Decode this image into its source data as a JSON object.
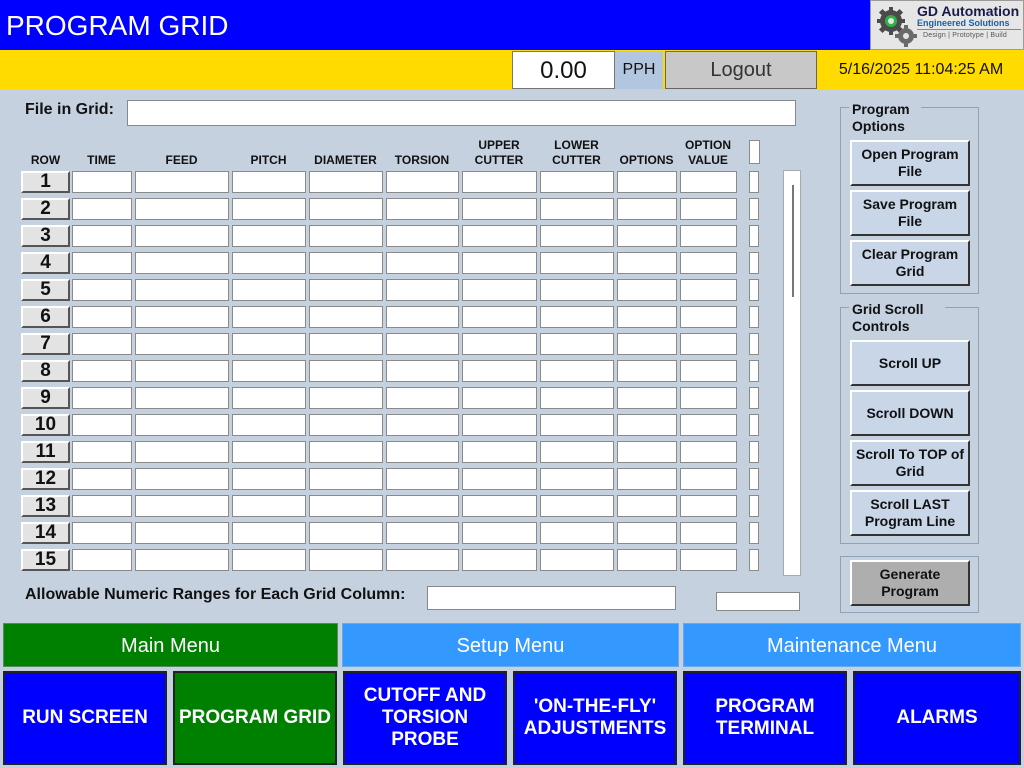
{
  "header": {
    "title": "PROGRAM GRID",
    "logo": {
      "name": "GD Automation",
      "tagline": "Engineered Solutions",
      "subline": "Design | Prototype | Build",
      "icon": "gear-logo-icon"
    }
  },
  "statusbar": {
    "pph_value": "0.00",
    "pph_label": "PPH",
    "logout_label": "Logout",
    "datetime": "5/16/2025 11:04:25 AM"
  },
  "file": {
    "label": "File in Grid:",
    "value": ""
  },
  "grid": {
    "columns": [
      "ROW",
      "TIME",
      "FEED",
      "PITCH",
      "DIAMETER",
      "TORSION",
      "UPPER CUTTER",
      "LOWER CUTTER",
      "OPTIONS",
      "OPTION VALUE"
    ],
    "rows": [
      "1",
      "2",
      "3",
      "4",
      "5",
      "6",
      "7",
      "8",
      "9",
      "10",
      "11",
      "12",
      "13",
      "14",
      "15"
    ],
    "cells": [
      [
        "",
        "",
        "",
        "",
        "",
        "",
        "",
        "",
        ""
      ],
      [
        "",
        "",
        "",
        "",
        "",
        "",
        "",
        "",
        ""
      ],
      [
        "",
        "",
        "",
        "",
        "",
        "",
        "",
        "",
        ""
      ],
      [
        "",
        "",
        "",
        "",
        "",
        "",
        "",
        "",
        ""
      ],
      [
        "",
        "",
        "",
        "",
        "",
        "",
        "",
        "",
        ""
      ],
      [
        "",
        "",
        "",
        "",
        "",
        "",
        "",
        "",
        ""
      ],
      [
        "",
        "",
        "",
        "",
        "",
        "",
        "",
        "",
        ""
      ],
      [
        "",
        "",
        "",
        "",
        "",
        "",
        "",
        "",
        ""
      ],
      [
        "",
        "",
        "",
        "",
        "",
        "",
        "",
        "",
        ""
      ],
      [
        "",
        "",
        "",
        "",
        "",
        "",
        "",
        "",
        ""
      ],
      [
        "",
        "",
        "",
        "",
        "",
        "",
        "",
        "",
        ""
      ],
      [
        "",
        "",
        "",
        "",
        "",
        "",
        "",
        "",
        ""
      ],
      [
        "",
        "",
        "",
        "",
        "",
        "",
        "",
        "",
        ""
      ],
      [
        "",
        "",
        "",
        "",
        "",
        "",
        "",
        "",
        ""
      ],
      [
        "",
        "",
        "",
        "",
        "",
        "",
        "",
        "",
        ""
      ]
    ]
  },
  "ranges": {
    "label": "Allowable Numeric Ranges for Each Grid Column:",
    "value": "",
    "extra_value": ""
  },
  "program_options": {
    "title": "Program Options",
    "buttons": [
      "Open Program File",
      "Save Program File",
      "Clear Program Grid"
    ]
  },
  "scroll_controls": {
    "title": "Grid Scroll Controls",
    "buttons": [
      "Scroll UP",
      "Scroll DOWN",
      "Scroll To TOP of Grid",
      "Scroll LAST Program Line"
    ]
  },
  "generate": {
    "label": "Generate Program"
  },
  "menus": {
    "main": "Main Menu",
    "setup": "Setup Menu",
    "maintenance": "Maintenance Menu"
  },
  "nav": [
    {
      "label": "RUN SCREEN",
      "active": false
    },
    {
      "label": "PROGRAM GRID",
      "active": true
    },
    {
      "label": "CUTOFF AND TORSION PROBE",
      "active": false
    },
    {
      "label": "'ON-THE-FLY' ADJUSTMENTS",
      "active": false
    },
    {
      "label": "PROGRAM TERMINAL",
      "active": false
    },
    {
      "label": "ALARMS",
      "active": false
    }
  ],
  "colors": {
    "title_bar": "#0000ff",
    "status_bar": "#ffdb00",
    "background": "#c5d1df",
    "main_menu": "#008000",
    "setup_menu": "#3399ff",
    "nav_button": "#0000ff",
    "nav_active": "#008000"
  }
}
